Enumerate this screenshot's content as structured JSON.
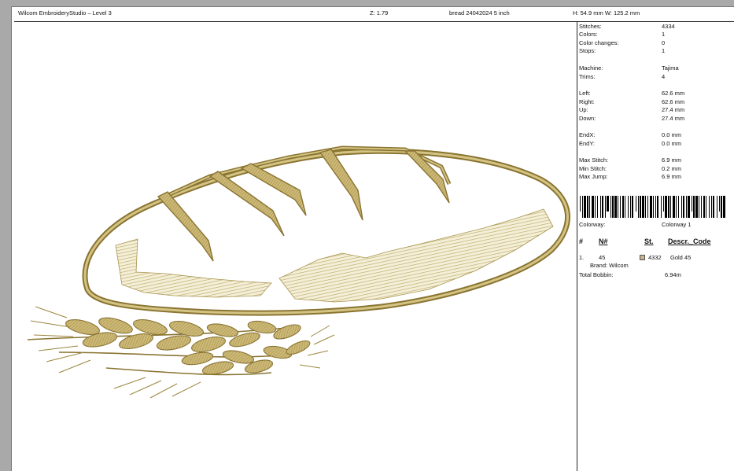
{
  "header": {
    "app_title": "Wilcom EmbroideryStudio – Level 3",
    "zoom": "Z: 1.79",
    "design_name": "bread 24042024 5 inch",
    "size": "H: 54.9 mm   W: 125.2 mm"
  },
  "stats": [
    {
      "label": "Stitches:",
      "value": "4334"
    },
    {
      "label": "Colors:",
      "value": "1"
    },
    {
      "label": "Color changes:",
      "value": "0"
    },
    {
      "label": "Stops:",
      "value": "1"
    },
    {
      "label": "Machine:",
      "value": "Tajima"
    },
    {
      "label": "Trims:",
      "value": "4"
    },
    {
      "label": "Left:",
      "value": "62.6 mm"
    },
    {
      "label": "Right:",
      "value": "62.6 mm"
    },
    {
      "label": "Up:",
      "value": "27.4 mm"
    },
    {
      "label": "Down:",
      "value": "27.4 mm"
    },
    {
      "label": "EndX:",
      "value": "0.0 mm"
    },
    {
      "label": "EndY:",
      "value": "0.0 mm"
    },
    {
      "label": "Max Stitch:",
      "value": "6.9 mm"
    },
    {
      "label": "Min Stitch:",
      "value": "0.2 mm"
    },
    {
      "label": "Max Jump:",
      "value": "6.9 mm"
    }
  ],
  "colorway": {
    "label": "Colorway:",
    "value": "Colorway 1"
  },
  "table": {
    "headers": [
      "#",
      "N#",
      "St.",
      "Descr._Code"
    ],
    "row": {
      "index": "1.",
      "number": "45",
      "stitches": "4332",
      "description": "Gold 45",
      "brand": "Brand: Wilcom",
      "swatch_color": "#c8b48a"
    },
    "total_bobbin_label": "Total Bobbin:",
    "total_bobbin_value": "6.94m"
  },
  "colors": {
    "thread": "#c2b06a",
    "thread_dark": "#8a7432",
    "thread_light": "#e4d8a8"
  }
}
